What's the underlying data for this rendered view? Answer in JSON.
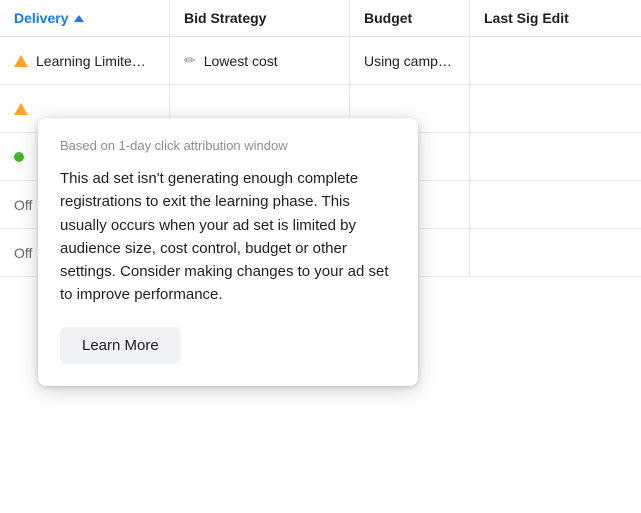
{
  "table": {
    "headers": {
      "delivery": "Delivery",
      "bid_strategy": "Bid Strategy",
      "budget": "Budget",
      "last_sig_edit": "Last Sig Edit"
    },
    "rows": [
      {
        "delivery": "Learning Limite…",
        "delivery_status": "warning",
        "bid_strategy": "Lowest cost",
        "budget": "Using camp…"
      },
      {
        "delivery": "",
        "delivery_status": "warning",
        "bid_strategy": "",
        "budget": ""
      },
      {
        "delivery": "",
        "delivery_status": "active",
        "bid_strategy": "",
        "budget": ""
      },
      {
        "delivery": "Off",
        "delivery_status": "off",
        "bid_strategy": "",
        "budget": ""
      },
      {
        "delivery": "Off",
        "delivery_status": "off",
        "bid_strategy": "",
        "budget": ""
      }
    ]
  },
  "popover": {
    "subtitle": "Based on 1-day click attribution window",
    "body": "This ad set isn't generating enough complete registrations to exit the learning phase. This usually occurs when your ad set is limited by audience size, cost control, budget or other settings. Consider making changes to your ad set to improve performance.",
    "learn_more_label": "Learn More"
  }
}
